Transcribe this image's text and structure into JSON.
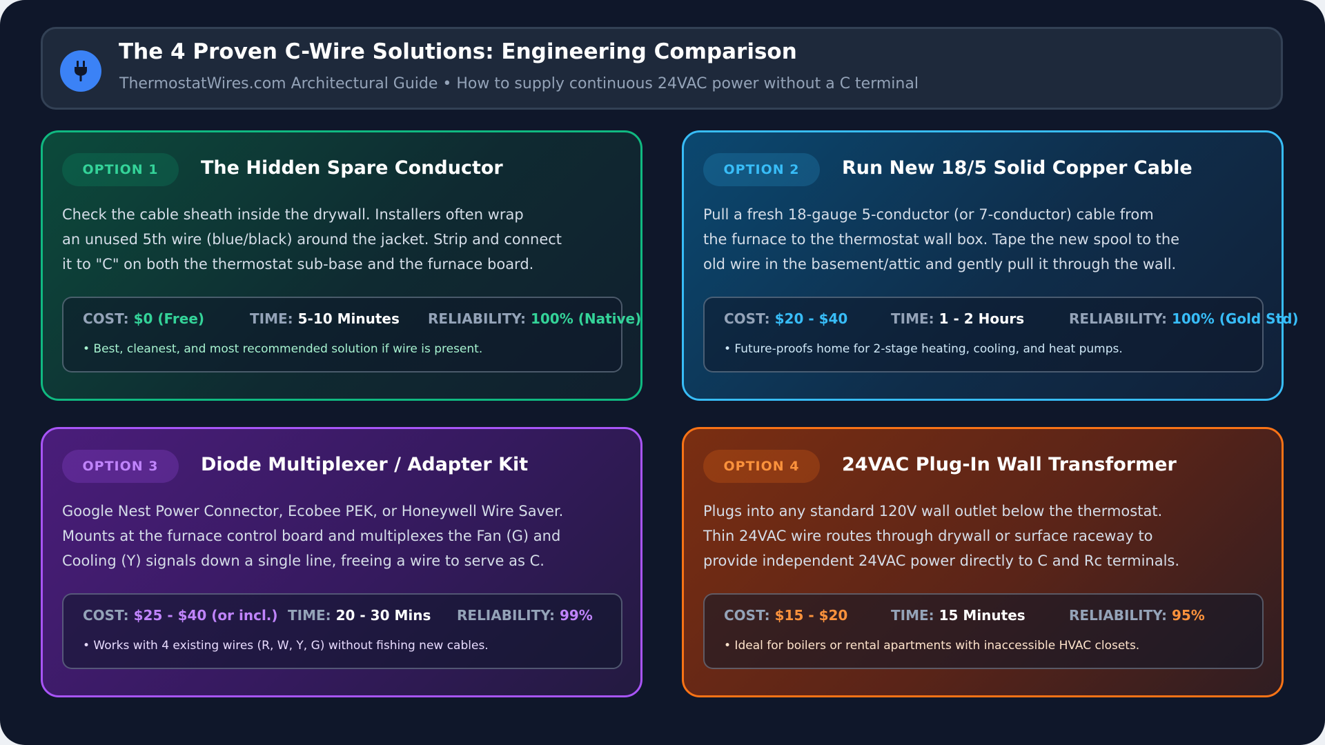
{
  "header": {
    "logo_icon": "power-plug-icon",
    "title": "The 4 Proven C-Wire Solutions: Engineering Comparison",
    "subtitle": "ThermostatWires.com Architectural Guide • How to supply continuous 24VAC power without a C terminal"
  },
  "labels": {
    "cost": "COST:",
    "time": "TIME:",
    "reliability": "RELIABILITY:"
  },
  "options": [
    {
      "badge": "OPTION 1",
      "title": "The Hidden Spare Conductor",
      "description": [
        "Check the cable sheath inside the drywall. Installers often wrap",
        "an unused 5th wire (blue/black) around the jacket. Strip and connect",
        "it to \"C\" on both the thermostat sub-base and the furnace board."
      ],
      "cost": "$0 (Free)",
      "time": "5-10 Minutes",
      "reliability": "100% (Native)",
      "note": "• Best, cleanest, and most recommended solution if wire is present.",
      "accent_color": "#10b981"
    },
    {
      "badge": "OPTION 2",
      "title": "Run New 18/5 Solid Copper Cable",
      "description": [
        "Pull a fresh 18-gauge 5-conductor (or 7-conductor) cable from",
        "the furnace to the thermostat wall box. Tape the new spool to the",
        "old wire in the basement/attic and gently pull it through the wall."
      ],
      "cost": "$20 - $40",
      "time": "1 - 2 Hours",
      "reliability": "100% (Gold Std)",
      "note": "• Future-proofs home for 2-stage heating, cooling, and heat pumps.",
      "accent_color": "#38bdf8"
    },
    {
      "badge": "OPTION 3",
      "title": "Diode Multiplexer / Adapter Kit",
      "description": [
        "Google Nest Power Connector, Ecobee PEK, or Honeywell Wire Saver.",
        "Mounts at the furnace control board and multiplexes the Fan (G) and",
        "Cooling (Y) signals down a single line, freeing a wire to serve as C."
      ],
      "cost": "$25 - $40 (or incl.)",
      "time": "20 - 30 Mins",
      "reliability": "99%",
      "note": "• Works with 4 existing wires (R, W, Y, G) without fishing new cables.",
      "accent_color": "#a855f7"
    },
    {
      "badge": "OPTION 4",
      "title": "24VAC Plug-In Wall Transformer",
      "description": [
        "Plugs into any standard 120V wall outlet below the thermostat.",
        "Thin 24VAC wire routes through drywall or surface raceway to",
        "provide independent 24VAC power directly to C and Rc terminals."
      ],
      "cost": "$15 - $20",
      "time": "15 Minutes",
      "reliability": "95%",
      "note": "• Ideal for boilers or rental apartments with inaccessible HVAC closets.",
      "accent_color": "#f97316"
    }
  ]
}
